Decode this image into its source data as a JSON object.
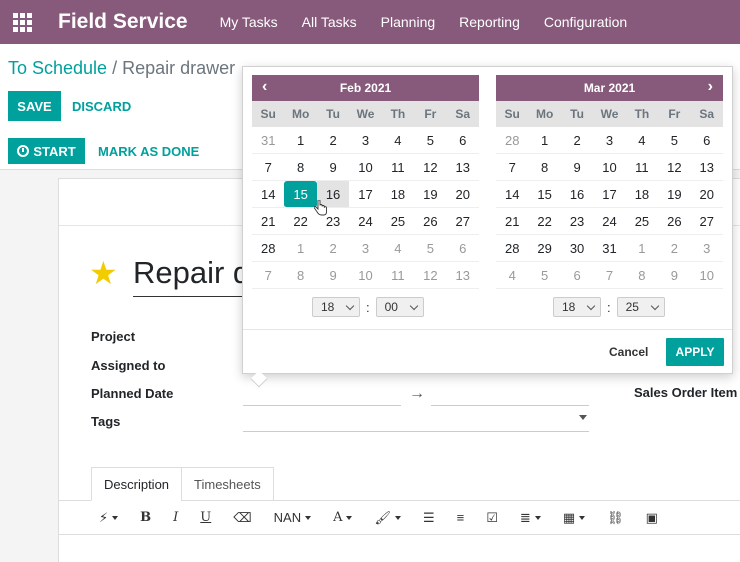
{
  "navbar": {
    "brand": "Field Service",
    "menu": [
      "My Tasks",
      "All Tasks",
      "Planning",
      "Reporting",
      "Configuration"
    ]
  },
  "breadcrumb": {
    "parent": "To Schedule",
    "separator": "/",
    "current": "Repair drawer"
  },
  "buttons": {
    "save": "SAVE",
    "discard": "DISCARD",
    "start": "START",
    "mark_done": "MARK AS DONE"
  },
  "form": {
    "title": "Repair d",
    "labels": {
      "project": "Project",
      "assigned_to": "Assigned to",
      "planned_date": "Planned Date",
      "tags": "Tags",
      "sales_order_item": "Sales Order Item"
    },
    "tabs": [
      "Description",
      "Timesheets"
    ],
    "toolbar": {
      "font_size": "NAN"
    }
  },
  "datepicker": {
    "weekdays": [
      "Su",
      "Mo",
      "Tu",
      "We",
      "Th",
      "Fr",
      "Sa"
    ],
    "left": {
      "month": "Feb 2021",
      "days": [
        [
          "31",
          "1",
          "2",
          "3",
          "4",
          "5",
          "6"
        ],
        [
          "7",
          "8",
          "9",
          "10",
          "11",
          "12",
          "13"
        ],
        [
          "14",
          "15",
          "16",
          "17",
          "18",
          "19",
          "20"
        ],
        [
          "21",
          "22",
          "23",
          "24",
          "25",
          "26",
          "27"
        ],
        [
          "28",
          "1",
          "2",
          "3",
          "4",
          "5",
          "6"
        ],
        [
          "7",
          "8",
          "9",
          "10",
          "11",
          "12",
          "13"
        ]
      ],
      "selected": "15",
      "hour": "18",
      "minute": "00"
    },
    "right": {
      "month": "Mar 2021",
      "days": [
        [
          "28",
          "1",
          "2",
          "3",
          "4",
          "5",
          "6"
        ],
        [
          "7",
          "8",
          "9",
          "10",
          "11",
          "12",
          "13"
        ],
        [
          "14",
          "15",
          "16",
          "17",
          "18",
          "19",
          "20"
        ],
        [
          "21",
          "22",
          "23",
          "24",
          "25",
          "26",
          "27"
        ],
        [
          "28",
          "29",
          "30",
          "31",
          "1",
          "2",
          "3"
        ],
        [
          "4",
          "5",
          "6",
          "7",
          "8",
          "9",
          "10"
        ]
      ],
      "hour": "18",
      "minute": "25"
    },
    "time_separator": ":",
    "cancel": "Cancel",
    "apply": "APPLY"
  },
  "colors": {
    "brand": "#875a7b",
    "accent": "#00a09d"
  }
}
